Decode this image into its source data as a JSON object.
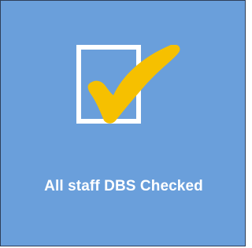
{
  "tile": {
    "background_color": "#6a9fdb",
    "icon": "checkbox-check-icon",
    "box_color": "#ffffff",
    "check_color": "#f6c000",
    "caption": "All staff DBS Checked"
  }
}
